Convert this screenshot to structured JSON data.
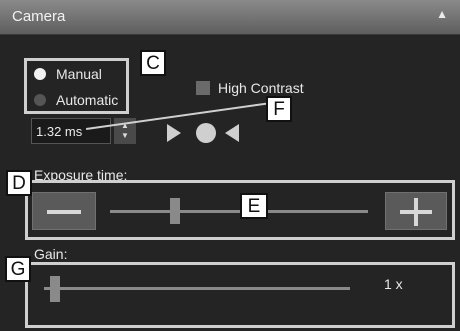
{
  "panel": {
    "title": "Camera",
    "collapse_icon": "chevron-up-icon"
  },
  "mode": {
    "options": [
      {
        "label": "Manual",
        "selected": true
      },
      {
        "label": "Automatic",
        "selected": false
      }
    ]
  },
  "high_contrast": {
    "label": "High Contrast",
    "checked": false
  },
  "exposure": {
    "value": "1.32 ms"
  },
  "exposure_time": {
    "label": "Exposure time:",
    "slider_position_fraction": 0.25
  },
  "gain": {
    "label": "Gain:",
    "value": "1 x",
    "slider_position_fraction": 0.02
  },
  "callouts": {
    "C": "C",
    "D": "D",
    "E": "E",
    "F": "F",
    "G": "G"
  }
}
